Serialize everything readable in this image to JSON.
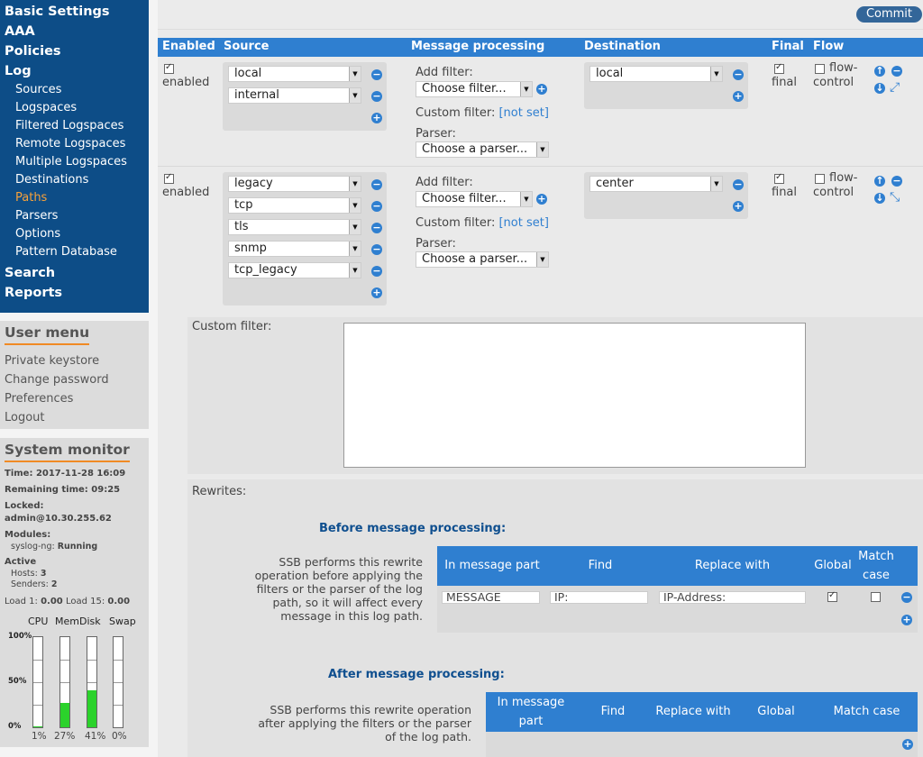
{
  "sidebar": {
    "nav": {
      "basic_settings": "Basic Settings",
      "aaa": "AAA",
      "policies": "Policies",
      "log": "Log",
      "log_items": [
        "Sources",
        "Logspaces",
        "Filtered Logspaces",
        "Remote Logspaces",
        "Multiple Logspaces",
        "Destinations",
        "Paths",
        "Parsers",
        "Options",
        "Pattern Database"
      ],
      "search": "Search",
      "reports": "Reports"
    },
    "user_menu": {
      "title": "User menu",
      "items": [
        "Private keystore",
        "Change password",
        "Preferences",
        "Logout"
      ]
    },
    "system_monitor": {
      "title": "System monitor",
      "time_label": "Time:",
      "time_value": "2017-11-28 16:09",
      "remaining_label": "Remaining time:",
      "remaining_value": "09:25",
      "locked_label": "Locked:",
      "locked_value": "admin@10.30.255.62",
      "modules_label": "Modules:",
      "module_name": "syslog-ng:",
      "module_status": "Running",
      "active_label": "Active",
      "hosts_label": "Hosts:",
      "hosts_value": "3",
      "senders_label": "Senders:",
      "senders_value": "2",
      "load1_label": "Load 1:",
      "load1_value": "0.00",
      "load15_label": "Load 15:",
      "load15_value": "0.00",
      "meter_labels": [
        "CPU",
        "Mem",
        "Disk",
        "Swap"
      ],
      "axis": [
        "100%",
        "50%",
        "0%"
      ],
      "meters": [
        {
          "name": "CPU",
          "percent": 1,
          "label": "1%"
        },
        {
          "name": "Mem",
          "percent": 27,
          "label": "27%"
        },
        {
          "name": "Disk",
          "percent": 41,
          "label": "41%"
        },
        {
          "name": "Swap",
          "percent": 0,
          "label": "0%"
        }
      ],
      "meter_color": "#2bd22b"
    }
  },
  "toolbar": {
    "commit_label": "Commit"
  },
  "table": {
    "headers": [
      "Enabled",
      "Source",
      "Message processing",
      "Destination",
      "Final",
      "Flow"
    ],
    "header_color": "#2f7fd0"
  },
  "paths": [
    {
      "enabled_label": "enabled",
      "sources": [
        "local",
        "internal"
      ],
      "add_filter_label": "Add filter:",
      "filter_select": "Choose filter...",
      "custom_filter_label": "Custom filter:",
      "custom_filter_value": "[not set]",
      "parser_label": "Parser:",
      "parser_select": "Choose a parser...",
      "destinations": [
        "local"
      ],
      "final_label": "final",
      "flow_label_1": "flow-",
      "flow_label_2": "control"
    },
    {
      "enabled_label": "enabled",
      "sources": [
        "legacy",
        "tcp",
        "tls",
        "snmp",
        "tcp_legacy"
      ],
      "add_filter_label": "Add filter:",
      "filter_select": "Choose filter...",
      "custom_filter_label": "Custom filter:",
      "custom_filter_value": "[not set]",
      "parser_label": "Parser:",
      "parser_select": "Choose a parser...",
      "destinations": [
        "center"
      ],
      "final_label": "final",
      "flow_label_1": "flow-",
      "flow_label_2": "control"
    }
  ],
  "custom_filter": {
    "label": "Custom filter:"
  },
  "rewrites": {
    "label": "Rewrites:",
    "before": {
      "title": "Before message processing:",
      "description": [
        "SSB performs this rewrite",
        "operation before applying the",
        "filters or the parser of the log",
        "path, so it will affect every",
        "message in this log path."
      ],
      "headers": [
        "In message part",
        "Find",
        "Replace with",
        "Global",
        "Match",
        "case"
      ],
      "row": {
        "part": "MESSAGE",
        "find": "IP:",
        "replace": "IP-Address:",
        "global": true,
        "match_case": false
      }
    },
    "after": {
      "title": "After message processing:",
      "description": [
        "SSB performs this rewrite operation",
        "after applying the filters or the parser",
        "of the log path."
      ],
      "headers": [
        "In message",
        "part",
        "Find",
        "Replace with",
        "Global",
        "Match case"
      ]
    }
  }
}
